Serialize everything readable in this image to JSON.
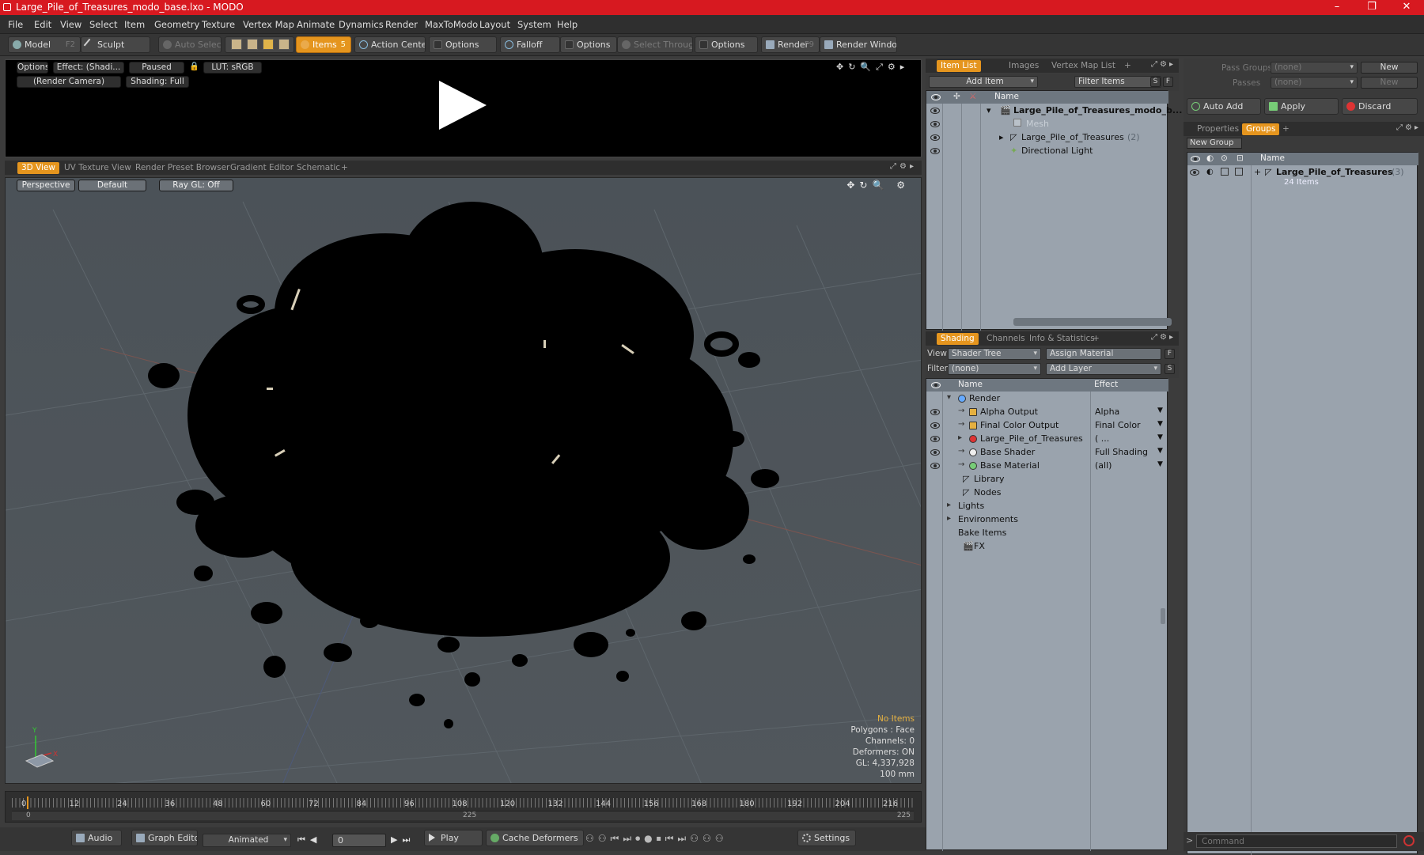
{
  "window": {
    "title": "Large_Pile_of_Treasures_modo_base.lxo - MODO",
    "minimize": "–",
    "maximize": "❐",
    "close": "✕"
  },
  "menu": [
    "File",
    "Edit",
    "View",
    "Select",
    "Item",
    "Geometry",
    "Texture",
    "Vertex Map",
    "Animate",
    "Dynamics",
    "Render",
    "MaxToModo",
    "Layout",
    "System",
    "Help"
  ],
  "toolbar": {
    "model": "Model",
    "model_key": "F2",
    "sculpt": "Sculpt",
    "auto_select": "Auto Select",
    "items": "Items",
    "items_key": "5",
    "action_center": "Action Center",
    "options1": "Options",
    "falloff": "Falloff",
    "options2": "Options",
    "select_through": "Select Through",
    "options3": "Options",
    "render": "Render",
    "render_key": "F9",
    "render_window": "Render Window"
  },
  "preview": {
    "options": "Options",
    "effect": "Effect: (Shadi...",
    "paused": "Paused",
    "lut": "LUT: sRGB",
    "camera": "(Render Camera)",
    "shading": "Shading: Full"
  },
  "viewport_tabs": [
    "3D View",
    "UV Texture View",
    "Render Preset Browser",
    "Gradient Editor",
    "Schematic",
    "+"
  ],
  "viewport": {
    "perspective": "Perspective",
    "default": "Default",
    "raygl": "Ray GL: Off",
    "axis_z": "Z",
    "axis_y": "Y",
    "axis_x": "X",
    "stats": {
      "items": "No Items",
      "polygons": "Polygons : Face",
      "channels": "Channels: 0",
      "deformers": "Deformers: ON",
      "gl": "GL: 4,337,928",
      "size": "100 mm"
    }
  },
  "timeline": {
    "ticks": [
      "0",
      "12",
      "24",
      "36",
      "48",
      "60",
      "72",
      "84",
      "96",
      "108",
      "120",
      "132",
      "144",
      "156",
      "168",
      "180",
      "192",
      "204",
      "216"
    ],
    "start": "0",
    "mid": "225",
    "end": "225"
  },
  "bottombar": {
    "audio": "Audio",
    "graph_editor": "Graph Editor",
    "animated": "Animated",
    "frame": "0",
    "play": "Play",
    "cache_deformers": "Cache Deformers",
    "settings": "Settings"
  },
  "item_list": {
    "tabs": [
      "Item List",
      "Images",
      "Vertex Map List",
      "+"
    ],
    "add_item": "Add Item",
    "filter_items": "Filter Items",
    "s": "S",
    "f": "F",
    "col_name": "Name",
    "rows": [
      {
        "label": "Large_Pile_of_Treasures_modo_b...",
        "count": ""
      },
      {
        "label": "Mesh",
        "count": ""
      },
      {
        "label": "Large_Pile_of_Treasures",
        "count": "(2)"
      },
      {
        "label": "Directional Light",
        "count": ""
      }
    ]
  },
  "shading": {
    "tabs": [
      "Shading",
      "Channels",
      "Info & Statistics",
      "+"
    ],
    "view_label": "View",
    "view_value": "Shader Tree",
    "assign_material": "Assign Material",
    "filter_label": "Filter",
    "filter_value": "(none)",
    "add_layer": "Add Layer",
    "f": "F",
    "s": "S",
    "col_name": "Name",
    "col_effect": "Effect",
    "rows": [
      {
        "name": "Render",
        "effect": ""
      },
      {
        "name": "Alpha Output",
        "effect": "Alpha"
      },
      {
        "name": "Final Color Output",
        "effect": "Final Color"
      },
      {
        "name": "Large_Pile_of_Treasures",
        "effect": "( ..."
      },
      {
        "name": "Base Shader",
        "effect": "Full Shading"
      },
      {
        "name": "Base Material",
        "effect": "(all)"
      },
      {
        "name": "Library",
        "effect": ""
      },
      {
        "name": "Nodes",
        "effect": ""
      },
      {
        "name": "Lights",
        "effect": ""
      },
      {
        "name": "Environments",
        "effect": ""
      },
      {
        "name": "Bake Items",
        "effect": ""
      },
      {
        "name": "FX",
        "effect": ""
      }
    ]
  },
  "groups": {
    "pass_groups_label": "Pass Groups",
    "pass_groups_value": "(none)",
    "new1": "New",
    "passes_label": "Passes",
    "passes_value": "(none)",
    "new2": "New",
    "auto_add": "Auto Add",
    "apply": "Apply",
    "discard": "Discard",
    "tabs": [
      "Properties",
      "Groups",
      "+"
    ],
    "new_group": "New Group",
    "col_name": "Name",
    "group_name": "Large_Pile_of_Treasures",
    "group_count": "(3)",
    "group_items": "24 Items"
  },
  "command": {
    "placeholder": "Command",
    "prompt": ">"
  }
}
